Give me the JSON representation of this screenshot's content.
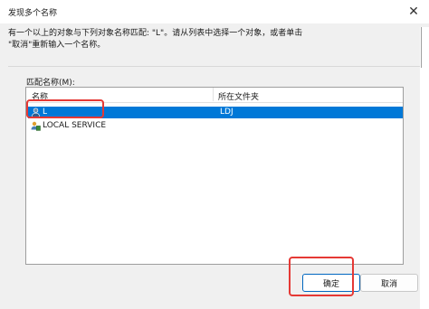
{
  "window": {
    "title": "发现多个名称",
    "close_glyph": "✕"
  },
  "description": [
    "有一个以上的对象与下列对象名称匹配: \"L\"。请从列表中选择一个对象，或者单击",
    "\"取消\"重新输入一个名称。"
  ],
  "list": {
    "label": "匹配名称(M):",
    "columns": [
      "名称",
      "所在文件夹"
    ],
    "rows": [
      {
        "name": "L",
        "folder": "LDJ",
        "selected": true,
        "icon": "user-icon"
      },
      {
        "name": "LOCAL SERVICE",
        "folder": "",
        "selected": false,
        "icon": "service-account-icon"
      }
    ]
  },
  "buttons": {
    "ok": "确定",
    "cancel": "取消"
  },
  "colors": {
    "selection": "#0078d7",
    "highlight_box": "#e53935",
    "primary_border": "#0067c0"
  }
}
